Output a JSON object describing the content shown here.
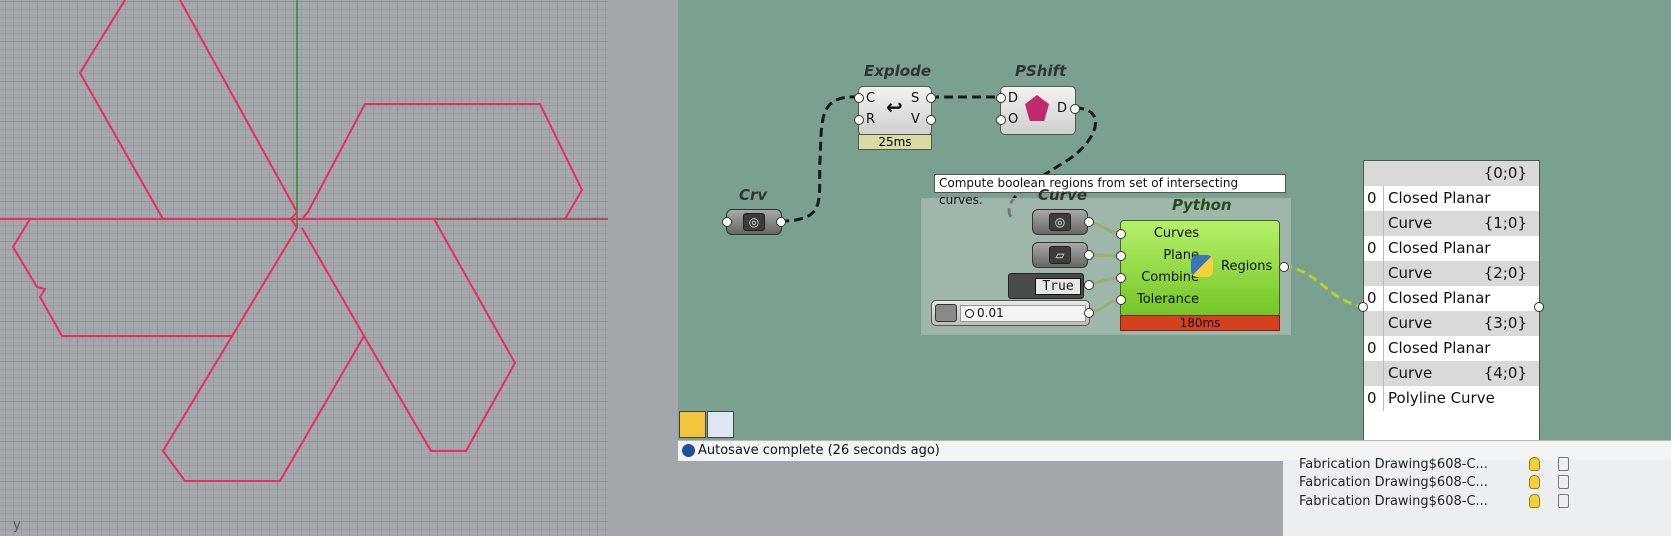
{
  "viewport": {
    "axis_label": "y"
  },
  "canvas": {
    "components": {
      "explode": {
        "title": "Explode",
        "inputs": [
          "C",
          "R"
        ],
        "outputs": [
          "S",
          "V"
        ],
        "timing": "25ms"
      },
      "pshift": {
        "title": "PShift",
        "inputs": [
          "D",
          "O"
        ],
        "outputs": [
          "D"
        ]
      },
      "crv": {
        "title": "Crv"
      },
      "curve": {
        "title": "Curve"
      },
      "python": {
        "title": "Python",
        "inputs": [
          "Curves",
          "Plane",
          "Combine",
          "Tolerance"
        ],
        "outputs": [
          "Regions"
        ],
        "timing": "180ms"
      },
      "toggle": {
        "value": "True"
      },
      "slider": {
        "value": "0.01"
      }
    },
    "tooltip": "Compute boolean regions from set of intersecting curves.",
    "panel": {
      "rows": [
        {
          "path": "{0;0}",
          "index": "0",
          "value": "Closed Planar Curve"
        },
        {
          "path": "{1;0}",
          "index": "0",
          "value": "Closed Planar Curve"
        },
        {
          "path": "{2;0}",
          "index": "0",
          "value": "Closed Planar Curve"
        },
        {
          "path": "{3;0}",
          "index": "0",
          "value": "Closed Planar Curve"
        },
        {
          "path": "{4;0}",
          "index": "0",
          "value": "Polyline Curve"
        }
      ]
    }
  },
  "status": {
    "message": "Autosave complete (26 seconds ago)"
  },
  "layers": {
    "rows": [
      "Fabrication Drawing$608-C...",
      "Fabrication Drawing$608-C...",
      "Fabrication Drawing$608-C..."
    ]
  },
  "colors": {
    "canvas_bg": "#7aa18f",
    "curve_stroke": "#ee2a5e",
    "python_green": "#8fdd3a",
    "timing_red": "#d4411f"
  }
}
